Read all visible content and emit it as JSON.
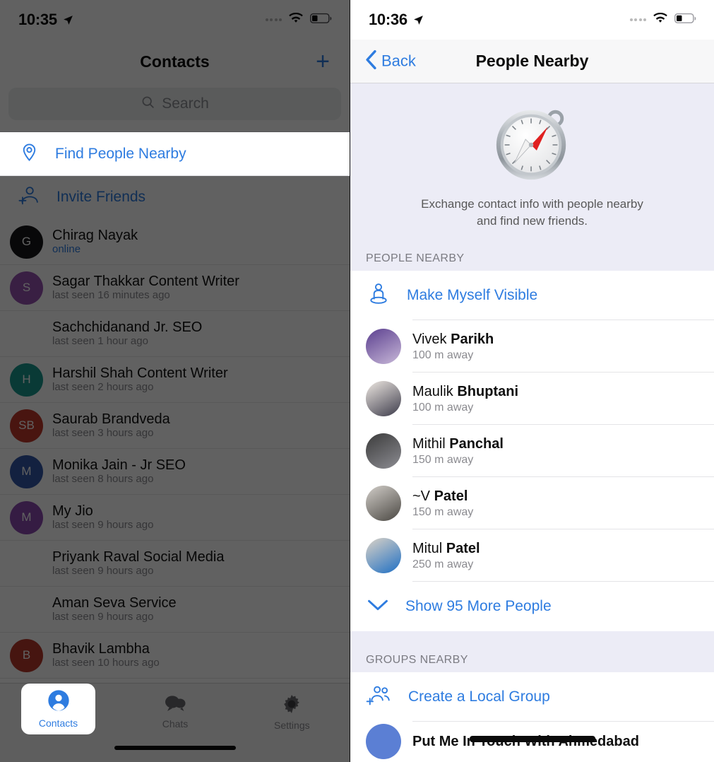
{
  "left": {
    "status": {
      "time": "10:35",
      "location_icon": "location-arrow-icon",
      "wifi_icon": "wifi-icon",
      "battery_icon": "battery-icon"
    },
    "nav": {
      "title": "Contacts",
      "add_icon": "plus-icon"
    },
    "search": {
      "placeholder": "Search",
      "icon": "search-icon"
    },
    "find_nearby": {
      "label": "Find People Nearby",
      "icon": "location-pin-icon"
    },
    "invite": {
      "label": "Invite Friends",
      "icon": "person-add-icon"
    },
    "contacts": [
      {
        "name": "Chirag Nayak",
        "status": "online",
        "online": true,
        "initials": "G",
        "color": "#15151a",
        "has_avatar": true
      },
      {
        "name": "Sagar Thakkar Content Writer",
        "status": "last seen 16 minutes ago",
        "online": false,
        "initials": "S",
        "color": "#9552b0",
        "has_avatar": true
      },
      {
        "name": "Sachchidanand Jr. SEO",
        "status": "last seen 1 hour ago",
        "online": false,
        "initials": "",
        "color": "",
        "has_avatar": false
      },
      {
        "name": "Harshil Shah Content Writer",
        "status": "last seen 2 hours ago",
        "online": false,
        "initials": "H",
        "color": "#19998f",
        "has_avatar": true
      },
      {
        "name": "Saurab Brandveda",
        "status": "last seen 3 hours ago",
        "online": false,
        "initials": "SB",
        "color": "#c0392b",
        "has_avatar": true
      },
      {
        "name": "Monika Jain - Jr SEO",
        "status": "last seen 8 hours ago",
        "online": false,
        "initials": "M",
        "color": "#3457a8",
        "has_avatar": true
      },
      {
        "name": "My Jio",
        "status": "last seen 9 hours ago",
        "online": false,
        "initials": "M",
        "color": "#8c4ab0",
        "has_avatar": true
      },
      {
        "name": "Priyank Raval Social Media",
        "status": "last seen 9 hours ago",
        "online": false,
        "initials": "",
        "color": "",
        "has_avatar": false
      },
      {
        "name": "Aman Seva Service",
        "status": "last seen 9 hours ago",
        "online": false,
        "initials": "",
        "color": "",
        "has_avatar": false
      },
      {
        "name": "Bhavik Lambha",
        "status": "last seen 10 hours ago",
        "online": false,
        "initials": "B",
        "color": "#b8392c",
        "has_avatar": true
      }
    ],
    "tabs": [
      {
        "label": "Contacts",
        "icon": "person-circle-icon",
        "active": true
      },
      {
        "label": "Chats",
        "icon": "chat-bubbles-icon",
        "active": false
      },
      {
        "label": "Settings",
        "icon": "gear-icon",
        "active": false
      }
    ]
  },
  "right": {
    "status": {
      "time": "10:36",
      "location_icon": "location-arrow-icon",
      "wifi_icon": "wifi-icon",
      "battery_icon": "battery-icon"
    },
    "nav": {
      "back_label": "Back",
      "back_icon": "chevron-left-icon",
      "title": "People Nearby"
    },
    "hero": {
      "icon": "compass-icon",
      "description_line1": "Exchange contact info with people nearby",
      "description_line2": "and find new friends."
    },
    "people_section": {
      "header": "PEOPLE NEARBY",
      "make_visible": {
        "label": "Make Myself Visible",
        "icon": "person-visible-icon"
      },
      "people": [
        {
          "first": "Vivek ",
          "last": "Parikh",
          "distance": "100 m away",
          "avatar_colors": [
            "#5b3f8f",
            "#c8b8d8"
          ]
        },
        {
          "first": "Maulik ",
          "last": "Bhuptani",
          "distance": "100 m away",
          "avatar_colors": [
            "#efe9e3",
            "#3c3b4a"
          ]
        },
        {
          "first": "Mithil ",
          "last": "Panchal",
          "distance": "150 m away",
          "avatar_colors": [
            "#3b3b3b",
            "#8c8c92"
          ]
        },
        {
          "first": "~V ",
          "last": "Patel",
          "distance": "150 m away",
          "avatar_colors": [
            "#d2cec9",
            "#4a4742"
          ]
        },
        {
          "first": "Mitul ",
          "last": "Patel",
          "distance": "250 m away",
          "avatar_colors": [
            "#dcd3c6",
            "#1f6fc4"
          ]
        }
      ],
      "show_more": {
        "label": "Show 95 More People",
        "icon": "chevron-down-icon",
        "count": 95
      }
    },
    "groups_section": {
      "header": "GROUPS NEARBY",
      "create_group": {
        "label": "Create a Local Group",
        "icon": "people-add-icon"
      },
      "last_group": {
        "name": "Put Me In Touch With Ahmedabad"
      }
    }
  },
  "colors": {
    "accent": "#2e7ce0",
    "lavender_bg": "#ececf6",
    "dim": "rgba(0,0,0,0.62)"
  }
}
